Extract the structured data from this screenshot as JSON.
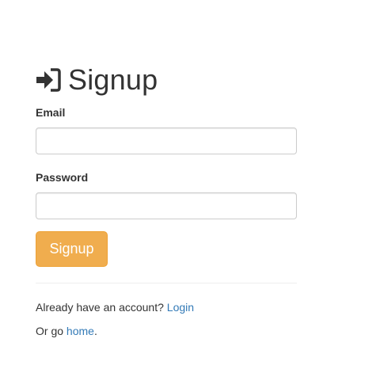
{
  "header": {
    "title": "Signup",
    "icon": "sign-in-icon"
  },
  "form": {
    "email_label": "Email",
    "email_value": "",
    "password_label": "Password",
    "password_value": "",
    "submit_label": "Signup",
    "submit_color": "#f0ad4e"
  },
  "footer": {
    "account_prompt": "Already have an account?",
    "login_link": "Login",
    "or_go_text": "Or go",
    "home_link": "home",
    "period": ".",
    "link_color": "#337ab7"
  }
}
